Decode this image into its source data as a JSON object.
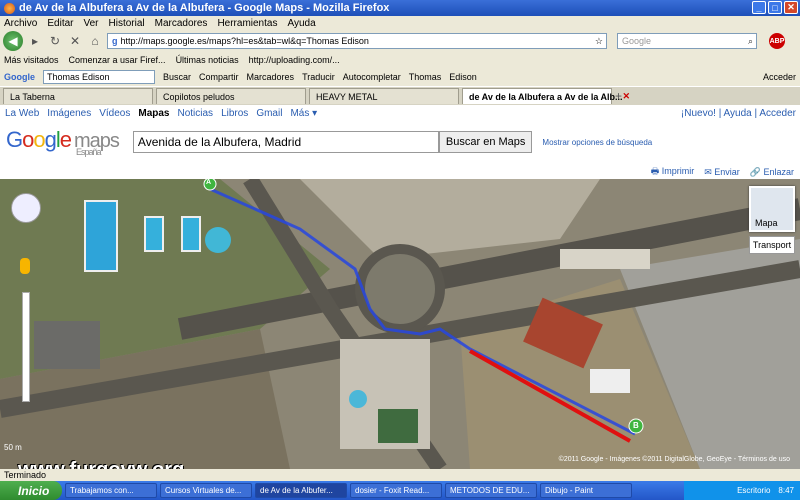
{
  "window": {
    "title": "de Av de la Albufera a Av de la Albufera - Google Maps - Mozilla Firefox"
  },
  "menu": [
    "Archivo",
    "Editar",
    "Ver",
    "Historial",
    "Marcadores",
    "Herramientas",
    "Ayuda"
  ],
  "nav": {
    "url": "http://maps.google.es/maps?hl=es&tab=wl&q=Thomas Edison",
    "search_placeholder": "Google"
  },
  "bookmarks": [
    "Más visitados",
    "Comenzar a usar Firef...",
    "Últimas noticias",
    "http://uploading.com/..."
  ],
  "google_toolbar": {
    "logo": "Google",
    "query": "Thomas Edison",
    "items": [
      "Buscar",
      "Compartir",
      "Marcadores",
      "Traducir",
      "Autocompletar",
      "Thomas",
      "Edison"
    ],
    "right": "Acceder"
  },
  "tabs": [
    {
      "label": "La Taberna"
    },
    {
      "label": "Copilotos peludos"
    },
    {
      "label": "HEAVY METAL"
    },
    {
      "label": "de Av de la Albufera a Av de la Alb..."
    }
  ],
  "gbar": {
    "links": [
      "La Web",
      "Imágenes",
      "Vídeos",
      "Mapas",
      "Noticias",
      "Libros",
      "Gmail",
      "Más ▾"
    ],
    "right": "¡Nuevo! | Ayuda | Acceder"
  },
  "header": {
    "logo_sub": "España",
    "query": "Avenida de la Albufera, Madrid",
    "button": "Buscar en Maps",
    "options": "Mostrar opciones de búsqueda"
  },
  "map_tools": [
    "Imprimir",
    "Enviar",
    "Enlazar"
  ],
  "map": {
    "minimap_label": "Mapa",
    "transport": "Transport",
    "scale": "50 m",
    "attribution": "©2011 Google - Imágenes ©2011 DigitalGlobe, GeoEye - Términos de uso",
    "marker_a": "A",
    "marker_b": "B"
  },
  "watermark": "www.furgovw.org",
  "statusbar": "Terminado",
  "taskbar": {
    "start": "Inicio",
    "items": [
      "Trabajamos con...",
      "Cursos Virtuales de...",
      "de Av de la Albufer...",
      "dosier - Foxit Read...",
      "METODOS DE EDU...",
      "Dibujo - Paint"
    ],
    "lang": "Escritorio",
    "time": "8:47"
  }
}
